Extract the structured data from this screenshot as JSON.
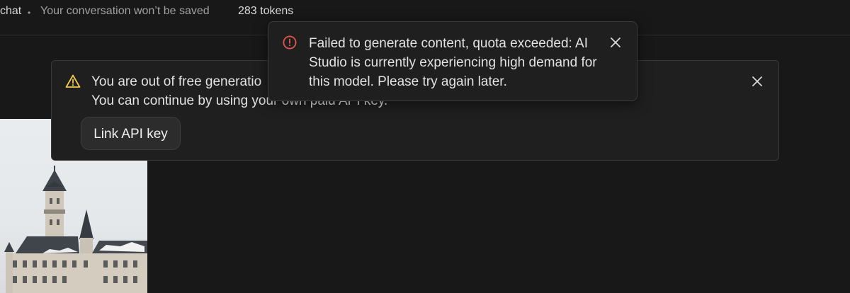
{
  "header": {
    "chat_title": "chat",
    "separator": "•",
    "not_saved": "Your conversation won’t be saved",
    "tokens": "283 tokens"
  },
  "warning_banner": {
    "line1": "You are out of free generatio",
    "line2": "You can continue by using your own paid API key.",
    "button_label": "Link API key",
    "icon": "warning-triangle-icon",
    "icon_color": "#f2c94c"
  },
  "error_toast": {
    "message": "Failed to generate content, quota exceeded: AI Studio is currently experiencing high demand for this model. Please try again later.",
    "icon": "error-circle-icon",
    "icon_color": "#e2574c"
  },
  "colors": {
    "background": "#181818",
    "panel": "#1f1f1f",
    "text": "#e3e3e3"
  }
}
